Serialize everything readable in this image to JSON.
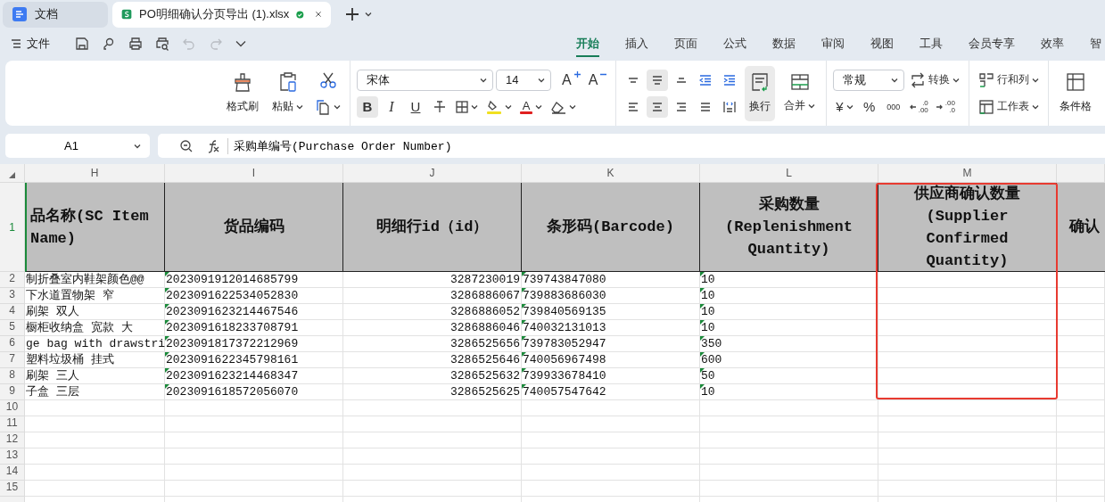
{
  "tabs": [
    {
      "label": "文档",
      "kind": "doc",
      "selected": false,
      "saved": false
    },
    {
      "label": "PO明细确认分页导出 (1).xlsx",
      "kind": "sheet",
      "selected": true,
      "saved": true
    }
  ],
  "quick_access": {
    "file": "文件",
    "undo": {
      "disabled": true
    },
    "redo": {
      "disabled": true
    }
  },
  "ribbon": {
    "tabs": [
      {
        "label": "开始",
        "selected": true
      },
      {
        "label": "插入",
        "selected": false
      },
      {
        "label": "页面",
        "selected": false
      },
      {
        "label": "公式",
        "selected": false
      },
      {
        "label": "数据",
        "selected": false
      },
      {
        "label": "审阅",
        "selected": false
      },
      {
        "label": "视图",
        "selected": false
      },
      {
        "label": "工具",
        "selected": false
      },
      {
        "label": "会员专享",
        "selected": false
      },
      {
        "label": "效率",
        "selected": false
      },
      {
        "label": "智",
        "selected": false
      }
    ],
    "format_painter": "格式刷",
    "paste": "粘贴",
    "font_name": "宋体",
    "font_size": "14",
    "grow_font": "A",
    "shrink_font": "A",
    "font_buttons": [
      {
        "label": "B",
        "selected": true
      },
      {
        "label": "I",
        "selected": false
      },
      {
        "label": "U",
        "selected": false
      }
    ],
    "font_color": "A",
    "align_top": [
      {
        "selected": false
      },
      {
        "selected": true
      },
      {
        "selected": false
      },
      {
        "selected": false
      },
      {
        "selected": false
      }
    ],
    "align_bottom": [
      {
        "selected": false
      },
      {
        "selected": true
      },
      {
        "selected": false
      },
      {
        "selected": false
      },
      {
        "selected": false
      }
    ],
    "wrap": {
      "label": "换行",
      "selected": true
    },
    "merge": "合并",
    "number_format": "常规",
    "convert": "转换",
    "currency": "¥",
    "percent": "%",
    "thousands": "000",
    "decimals": [
      {
        "top": ".0",
        "bottom": ".00"
      },
      {
        "top": ".00",
        "bottom": ".0"
      }
    ],
    "rows_cols": "行和列",
    "worksheet": "工作表",
    "conditional": "条件格"
  },
  "formula_bar": {
    "cell": "A1",
    "formula": "采购单编号(Purchase Order Number)"
  },
  "sheet": {
    "columns": [
      {
        "letter": "H",
        "kind": "text",
        "flagged": false,
        "highlighted": false,
        "header": "品名称(SC Item Name)"
      },
      {
        "letter": "I",
        "kind": "text",
        "flagged": true,
        "highlighted": false,
        "header": "货品编码"
      },
      {
        "letter": "J",
        "kind": "number",
        "flagged": false,
        "highlighted": false,
        "header": "明细行id（id）"
      },
      {
        "letter": "K",
        "kind": "text",
        "flagged": true,
        "highlighted": false,
        "header": "条形码(Barcode)"
      },
      {
        "letter": "L",
        "kind": "text",
        "flagged": true,
        "highlighted": false,
        "header": "采购数量(Replenishment Quantity)"
      },
      {
        "letter": "M",
        "kind": "text",
        "flagged": false,
        "highlighted": true,
        "header": "供应商确认数量(Supplier Confirmed Quantity)"
      },
      {
        "kind": "text",
        "flagged": false,
        "highlighted": false,
        "header": "确认"
      }
    ],
    "header_row": "1",
    "rows": [
      {
        "number": "2",
        "cells": [
          "制折叠室内鞋架颜色@@",
          "2023091912014685799",
          "3287230019",
          "739743847080",
          "10"
        ]
      },
      {
        "number": "3",
        "cells": [
          "下水道置物架 窄",
          "2023091622534052830",
          "3286886067",
          "739883686030",
          "10"
        ]
      },
      {
        "number": "4",
        "cells": [
          "刷架 双人",
          "2023091623214467546",
          "3286886052",
          "739840569135",
          "10"
        ]
      },
      {
        "number": "5",
        "cells": [
          "橱柜收纳盒 宽款 大",
          "2023091618233708791",
          "3286886046",
          "740032131013",
          "10"
        ]
      },
      {
        "number": "6",
        "cells": [
          "ge bag with drawstri",
          "2023091817372212969",
          "3286525656",
          "739783052947",
          "350"
        ]
      },
      {
        "number": "7",
        "cells": [
          "塑料垃圾桶 挂式",
          "2023091622345798161",
          "3286525646",
          "740056967498",
          "600"
        ]
      },
      {
        "number": "8",
        "cells": [
          "刷架 三人",
          "2023091623214468347",
          "3286525632",
          "739933678410",
          "50"
        ]
      },
      {
        "number": "9",
        "cells": [
          "子盒 三层",
          "2023091618572056070",
          "3286525625",
          "740057547642",
          "10"
        ]
      }
    ],
    "empty_rows": [
      "10",
      "11",
      "12",
      "13",
      "14",
      "15"
    ]
  }
}
